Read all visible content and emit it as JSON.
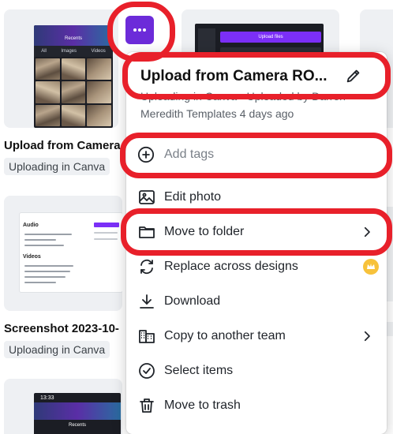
{
  "colors": {
    "accent_purple": "#6c2bd9",
    "highlight_red": "#e8202a",
    "crown_gold": "#f7c23b"
  },
  "cards": [
    {
      "title": "Upload from Camera",
      "subtitle": "Uploading in Canva",
      "preview_heading": "Recents",
      "preview_tabs": [
        "All",
        "Images",
        "Videos"
      ]
    },
    {
      "title": "Screenshot 2023-10-",
      "subtitle": "Uploading in Canva",
      "preview_heading": "Audio",
      "preview_heading2": "Videos"
    },
    {
      "preview_status_time": "13:33",
      "preview_heading": "Recents"
    }
  ],
  "second_column_card": {
    "upload_button": "Upload files"
  },
  "more_button": {
    "icon": "more-horizontal-icon"
  },
  "menu": {
    "title": "Upload from Camera RO...",
    "meta_line1": "Uploading in Canva · Uploaded by Darren",
    "meta_line2": "Meredith Templates 4 days ago",
    "add_tags": "Add tags",
    "items": [
      {
        "label": "Edit photo",
        "icon": "image-edit-icon"
      },
      {
        "label": "Move to folder",
        "icon": "folder-icon",
        "has_submenu": true
      },
      {
        "label": "Replace across designs",
        "icon": "replace-icon",
        "premium": true
      },
      {
        "label": "Download",
        "icon": "download-icon"
      },
      {
        "label": "Copy to another team",
        "icon": "team-copy-icon",
        "has_submenu": true
      },
      {
        "label": "Select items",
        "icon": "check-circle-icon"
      },
      {
        "label": "Move to trash",
        "icon": "trash-icon"
      }
    ]
  }
}
